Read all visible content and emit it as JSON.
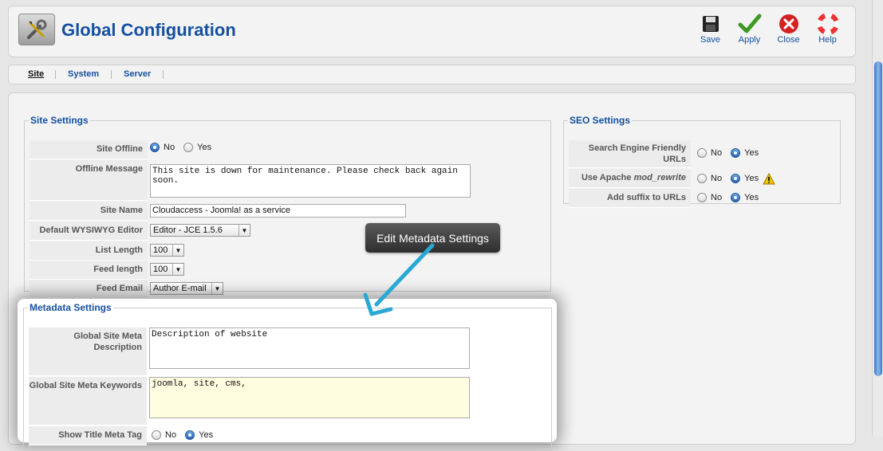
{
  "header": {
    "title": "Global Configuration"
  },
  "toolbar": {
    "save": "Save",
    "apply": "Apply",
    "close": "Close",
    "help": "Help"
  },
  "tabs": {
    "site": "Site",
    "system": "System",
    "server": "Server"
  },
  "site_settings": {
    "legend": "Site Settings",
    "site_offline": {
      "label": "Site Offline",
      "no": "No",
      "yes": "Yes",
      "selected": "No"
    },
    "offline_message": {
      "label": "Offline Message",
      "value": "This site is down for maintenance. Please check back again soon."
    },
    "site_name": {
      "label": "Site Name",
      "value": "Cloudaccess - Joomla! as a service"
    },
    "editor": {
      "label": "Default WYSIWYG Editor",
      "value": "Editor - JCE 1.5.6"
    },
    "list_length": {
      "label": "List Length",
      "value": "100"
    },
    "feed_length": {
      "label": "Feed length",
      "value": "100"
    },
    "feed_email": {
      "label": "Feed Email",
      "value": "Author E-mail"
    }
  },
  "seo_settings": {
    "legend": "SEO Settings",
    "sef_urls": {
      "label": "Search Engine Friendly URLs",
      "no": "No",
      "yes": "Yes",
      "selected": "Yes"
    },
    "mod_rewrite": {
      "label_prefix": "Use Apache",
      "label_em": "mod_rewrite",
      "no": "No",
      "yes": "Yes",
      "selected": "Yes"
    },
    "suffix": {
      "label": "Add suffix to URLs",
      "no": "No",
      "yes": "Yes",
      "selected": "Yes"
    }
  },
  "tooltip": {
    "text": "Edit Metadata Settings"
  },
  "metadata_settings": {
    "legend": "Metadata Settings",
    "description": {
      "label": "Global Site Meta Description",
      "value": "Description of website"
    },
    "keywords": {
      "label": "Global Site Meta Keywords",
      "value": "joomla, site, cms,"
    },
    "show_title": {
      "label": "Show Title Meta Tag",
      "no": "No",
      "yes": "Yes",
      "selected": "Yes"
    }
  },
  "colors": {
    "accent": "#1450a0",
    "tooltip_bg": "#3a3a3a",
    "arrow": "#29a8d6"
  }
}
